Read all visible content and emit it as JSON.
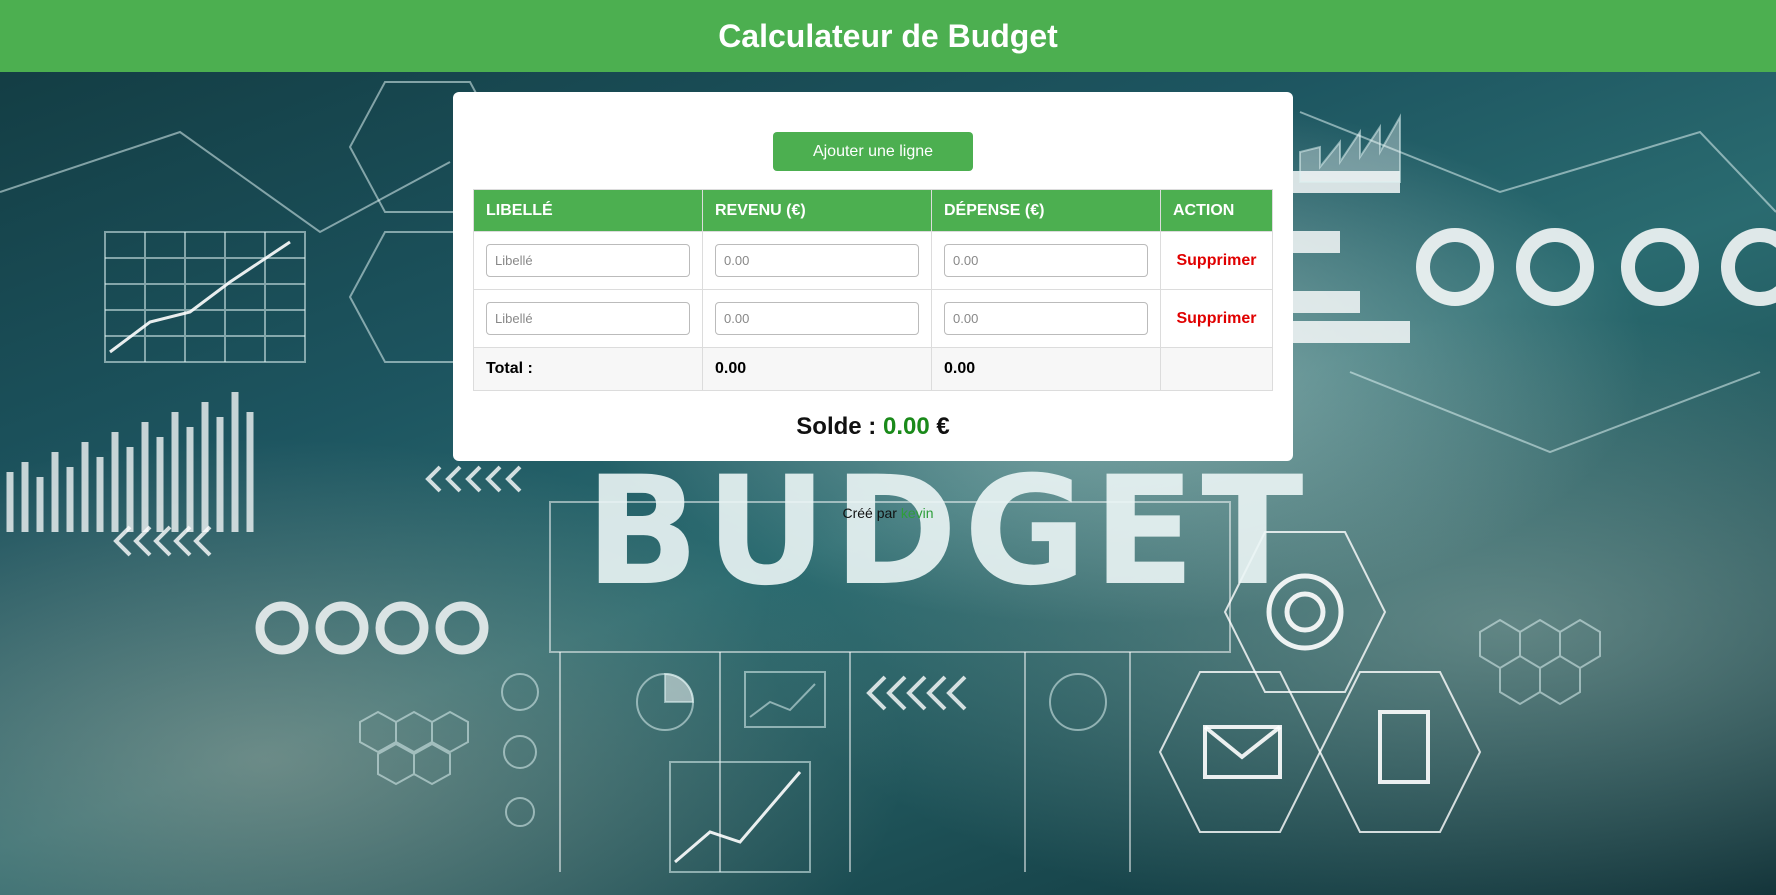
{
  "header": {
    "title": "Calculateur de Budget"
  },
  "toolbar": {
    "add_label": "Ajouter une ligne"
  },
  "table": {
    "columns": [
      "LIBELLÉ",
      "REVENU (€)",
      "DÉPENSE (€)",
      "ACTION"
    ],
    "rows": [
      {
        "label_placeholder": "Libellé",
        "revenue_placeholder": "0.00",
        "expense_placeholder": "0.00",
        "action": "Supprimer"
      },
      {
        "label_placeholder": "Libellé",
        "revenue_placeholder": "0.00",
        "expense_placeholder": "0.00",
        "action": "Supprimer"
      }
    ],
    "total": {
      "label": "Total :",
      "revenue": "0.00",
      "expense": "0.00"
    }
  },
  "balance": {
    "label": "Solde :",
    "value": "0.00",
    "currency": "€"
  },
  "footer": {
    "prefix": "Créé par",
    "author": "kevin"
  },
  "background": {
    "word": "BUDGET"
  },
  "colors": {
    "accent": "#4caf50",
    "danger": "#e00000",
    "positive": "#1a8a1a"
  }
}
